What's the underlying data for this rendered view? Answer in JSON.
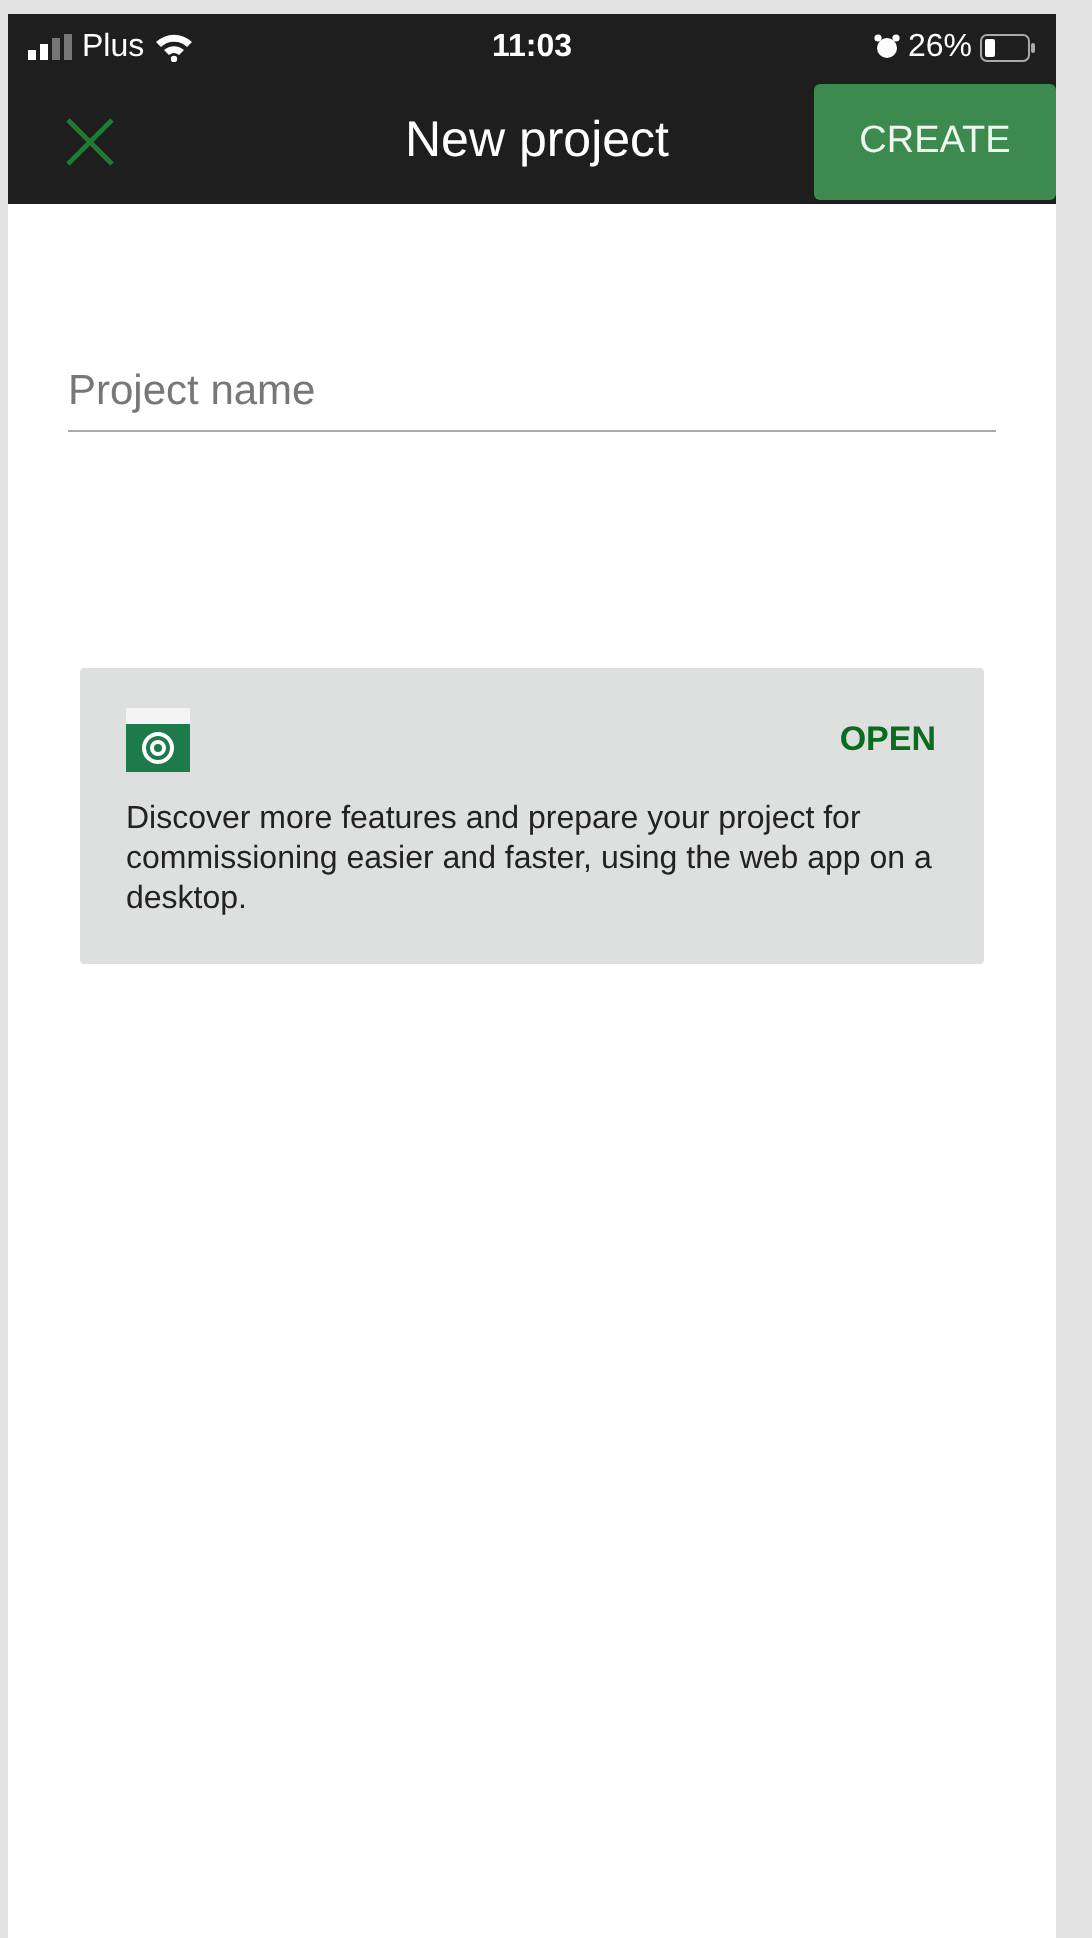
{
  "status_bar": {
    "carrier": "Plus",
    "time": "11:03",
    "battery": "26%"
  },
  "header": {
    "title": "New project",
    "action": "CREATE"
  },
  "form": {
    "project_name": {
      "placeholder": "Project name"
    }
  },
  "promo_card": {
    "action": "OPEN",
    "text": "Discover more features and prepare your project for commissioning easier and faster, using the web app on a desktop."
  }
}
